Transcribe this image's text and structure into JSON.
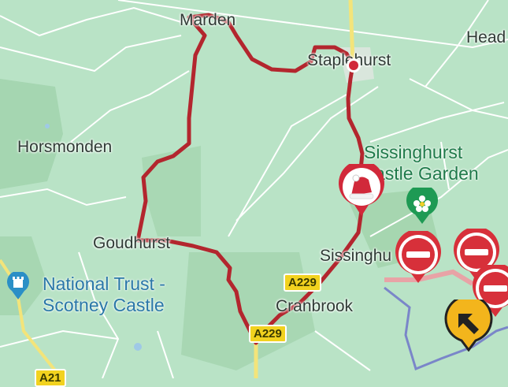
{
  "places": {
    "marden": "Marden",
    "staplehurst": "Staplehurst",
    "headcorn": "Head",
    "horsmonden": "Horsmonden",
    "goudhurst": "Goudhurst",
    "sissinghurst": "Sissinghu",
    "cranbrook": "Cranbrook"
  },
  "pois": {
    "sissinghurst_garden_line1": "Sissinghurst",
    "sissinghurst_garden_line2": "astle Garden",
    "scotney_line1": "National Trust -",
    "scotney_line2": "Scotney Castle"
  },
  "roads": {
    "a229_upper": "A229",
    "a229_lower": "A229",
    "a21": "A21"
  },
  "icons": {
    "route_start": "red-dot-icon",
    "santa_marker": "santa-hat-pin-icon",
    "garden_marker": "flower-pin-icon",
    "closures": [
      "no-entry-icon",
      "no-entry-icon",
      "no-entry-icon"
    ],
    "navigation": "navigation-arrow-icon"
  },
  "colors": {
    "land": "#b9e3c6",
    "route": "#b3262e",
    "road": "#ffffff",
    "yellow_road": "#f3e47a",
    "closure_red": "#d7303a"
  }
}
